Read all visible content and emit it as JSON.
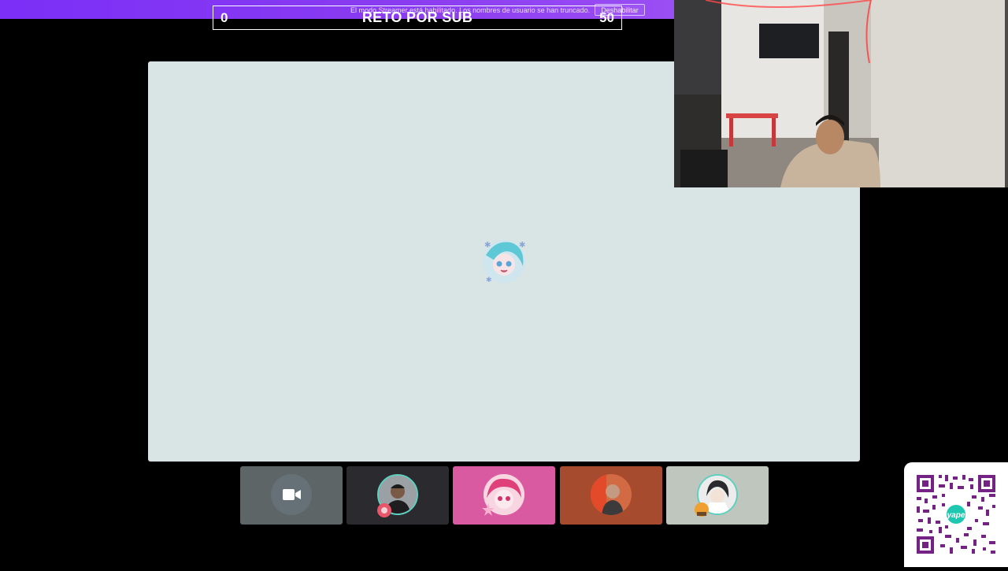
{
  "streamer_mode": {
    "notice": "El modo Streamer está habilitado. Los nombres de usuario se han truncado.",
    "disable_label": "Deshabilitar",
    "bar_color": "#7b2ff7"
  },
  "goal": {
    "current": "0",
    "title": "RETO POR SUB",
    "target": "50"
  },
  "stage": {
    "background": "#d9e4e4",
    "center_avatar_icon": "anime-avatar-icon"
  },
  "participants": [
    {
      "icon": "camera-icon",
      "tile_color": "#5e6566"
    },
    {
      "icon": "user-avatar-icon",
      "tile_color": "#2b2a2e"
    },
    {
      "icon": "anime-avatar-icon",
      "tile_color": "#d95aa0"
    },
    {
      "icon": "user-avatar-icon",
      "tile_color": "#a64b2e"
    },
    {
      "icon": "anime-avatar-icon",
      "tile_color": "#bfc6bd"
    }
  ],
  "qr": {
    "brand": "yape",
    "brand_color": "#742284"
  }
}
